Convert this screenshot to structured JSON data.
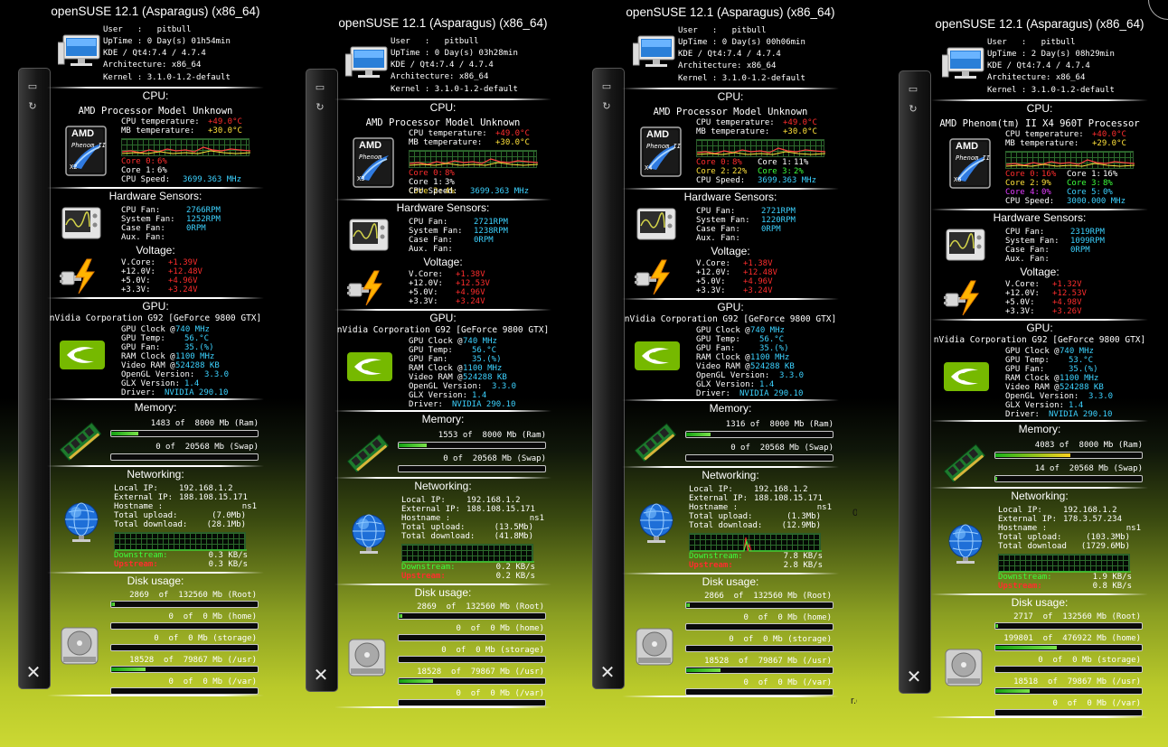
{
  "screenshots": [
    {
      "system": {
        "title": "openSUSE 12.1 (Asparagus) (x86_64)",
        "user": "User   :   pitbull",
        "uptime": "UpTime : 0 Day(s) 01h54min",
        "kde": "KDE / Qt4:7.4 / 4.7.4",
        "arch": "Architecture: x86_64",
        "kernel": "Kernel : 3.1.0-1.2-default"
      },
      "cpu": {
        "section": "CPU:",
        "name": "AMD Processor Model Unknown",
        "cpu_temp_label": "CPU temperature:",
        "cpu_temp": "+49.0°C",
        "mb_temp_label": "MB temperature:",
        "mb_temp": "+30.0°C",
        "cores": [
          {
            "label": "Core 0:",
            "value": "6%",
            "color": "rd"
          },
          {
            "label": "Core 1:",
            "value": "6%",
            "color": "lbl"
          }
        ],
        "speed_label": "CPU Speed:",
        "speed": "3699.363 MHz",
        "chip_brand": "AMD",
        "chip_model": "Phenom II",
        "chip_cores": "X2"
      },
      "sensors": {
        "section": "Hardware Sensors:",
        "cpu_fan_label": "CPU Fan:",
        "cpu_fan": "2766RPM",
        "sys_fan_label": "System Fan:",
        "sys_fan": "1252RPM",
        "case_fan_label": "Case Fan:",
        "case_fan": "0RPM",
        "aux_fan_label": "Aux. Fan:",
        "aux_fan": ""
      },
      "voltage": {
        "section": "Voltage:",
        "vcore_label": "V.Core:",
        "vcore": "+1.39V",
        "v12_label": "+12.0V:",
        "v12": "+12.48V",
        "v5_label": "+5.0V:",
        "v5": "+4.96V",
        "v33_label": "+3.3V:",
        "v33": "+3.24V"
      },
      "gpu": {
        "section": "GPU:",
        "name": "nVidia Corporation G92 [GeForce 9800 GTX]",
        "clock_label": "GPU Clock @",
        "clock": "740 MHz",
        "temp_label": "GPU Temp:",
        "temp": "56.°C",
        "fan_label": "GPU Fan:",
        "fan": "35.(%)",
        "ram_clock_label": "RAM Clock @",
        "ram_clock": "1100 MHz",
        "vram_label": "Video RAM @",
        "vram": "524288 KB",
        "opengl_label": "OpenGL Version:",
        "opengl": "3.3.0",
        "glx_label": "GLX Version:",
        "glx": "1.4",
        "driver_label": "Driver:",
        "driver": "NVIDIA 290.10"
      },
      "memory": {
        "section": "Memory:",
        "ram_text": "1483 of  8000 Mb (Ram)",
        "ram_fraction": 0.185,
        "swap_text": "0 of  20568 Mb (Swap)",
        "swap_fraction": 0.0
      },
      "network": {
        "section": "Networking:",
        "local_ip_label": "Local IP:",
        "local_ip": "192.168.1.2",
        "ext_ip_label": "External IP:",
        "ext_ip": "188.108.15.171",
        "hostname_label": "Hostname :",
        "hostname": "ns1",
        "upload_label": "Total upload:",
        "upload": "(7.0Mb)",
        "download_label": "Total download:",
        "download": "(28.1Mb)",
        "down_rate_label": "Downstream:",
        "down_rate": "0.3 KB/s",
        "up_rate_label": "Upstream:",
        "up_rate": "0.3 KB/s",
        "graph_spike": false
      },
      "disk": {
        "section": "Disk usage:",
        "rows": [
          {
            "text": "2869  of  132560 Mb (Root)",
            "fraction": 0.022
          },
          {
            "text": "0  of  0 Mb (home)",
            "fraction": 0
          },
          {
            "text": "0  of  0 Mb (storage)",
            "fraction": 0
          },
          {
            "text": "18528  of  79867 Mb (/usr)",
            "fraction": 0.232
          },
          {
            "text": "0  of  0 Mb (/var)",
            "fraction": 0
          }
        ]
      }
    },
    {
      "system": {
        "title": "openSUSE 12.1 (Asparagus) (x86_64)",
        "user": "User   :   pitbull",
        "uptime": "UpTime : 0 Day(s) 03h28min",
        "kde": "KDE / Qt4:7.4 / 4.7.4",
        "arch": "Architecture: x86_64",
        "kernel": "Kernel : 3.1.0-1.2-default"
      },
      "cpu": {
        "section": "CPU:",
        "name": "AMD Processor Model Unknown",
        "cpu_temp_label": "CPU temperature:",
        "cpu_temp": "+49.0°C",
        "mb_temp_label": "MB temperature:",
        "mb_temp": "+30.0°C",
        "cores": [
          {
            "label": "Core 0:",
            "value": "8%",
            "color": "rd"
          },
          {
            "label": "Core 1:",
            "value": "3%",
            "color": "lbl"
          },
          {
            "label": "Core 2:",
            "value": "4%",
            "color": "yl"
          }
        ],
        "speed_label": "CPU Speed:",
        "speed": "3699.363 MHz",
        "chip_brand": "AMD",
        "chip_model": "Phenom",
        "chip_cores": "X3"
      },
      "sensors": {
        "section": "Hardware Sensors:",
        "cpu_fan_label": "CPU Fan:",
        "cpu_fan": "2721RPM",
        "sys_fan_label": "System Fan:",
        "sys_fan": "1238RPM",
        "case_fan_label": "Case Fan:",
        "case_fan": "0RPM",
        "aux_fan_label": "Aux. Fan:",
        "aux_fan": ""
      },
      "voltage": {
        "section": "Voltage:",
        "vcore_label": "V.Core:",
        "vcore": "+1.38V",
        "v12_label": "+12.0V:",
        "v12": "+12.53V",
        "v5_label": "+5.0V:",
        "v5": "+4.96V",
        "v33_label": "+3.3V:",
        "v33": "+3.24V"
      },
      "gpu": {
        "section": "GPU:",
        "name": "nVidia Corporation G92 [GeForce 9800 GTX]",
        "clock_label": "GPU Clock @",
        "clock": "740 MHz",
        "temp_label": "GPU Temp:",
        "temp": "56.°C",
        "fan_label": "GPU Fan:",
        "fan": "35.(%)",
        "ram_clock_label": "RAM Clock @",
        "ram_clock": "1100 MHz",
        "vram_label": "Video RAM @",
        "vram": "524288 KB",
        "opengl_label": "OpenGL Version:",
        "opengl": "3.3.0",
        "glx_label": "GLX Version:",
        "glx": "1.4",
        "driver_label": "Driver:",
        "driver": "NVIDIA 290.10"
      },
      "memory": {
        "section": "Memory:",
        "ram_text": "1553 of  8000 Mb (Ram)",
        "ram_fraction": 0.194,
        "swap_text": "0 of  20568 Mb (Swap)",
        "swap_fraction": 0.0
      },
      "network": {
        "section": "Networking:",
        "local_ip_label": "Local IP:",
        "local_ip": "192.168.1.2",
        "ext_ip_label": "External IP:",
        "ext_ip": "188.108.15.171",
        "hostname_label": "Hostname :",
        "hostname": "ns1",
        "upload_label": "Total upload:",
        "upload": "(13.5Mb)",
        "download_label": "Total download:",
        "download": "(41.8Mb)",
        "down_rate_label": "Downstream:",
        "down_rate": "0.2 KB/s",
        "up_rate_label": "Upstream:",
        "up_rate": "0.2 KB/s",
        "graph_spike": false
      },
      "disk": {
        "section": "Disk usage:",
        "rows": [
          {
            "text": "2869  of  132560 Mb (Root)",
            "fraction": 0.022
          },
          {
            "text": "0  of  0 Mb (home)",
            "fraction": 0
          },
          {
            "text": "0  of  0 Mb (storage)",
            "fraction": 0
          },
          {
            "text": "18528  of  79867 Mb (/usr)",
            "fraction": 0.232
          },
          {
            "text": "0  of  0 Mb (/var)",
            "fraction": 0
          }
        ]
      }
    },
    {
      "system": {
        "title": "openSUSE 12.1 (Asparagus) (x86_64)",
        "user": "User   :   pitbull",
        "uptime": "UpTime : 0 Day(s) 00h06min",
        "kde": "KDE / Qt4:7.4 / 4.7.4",
        "arch": "Architecture: x86_64",
        "kernel": "Kernel : 3.1.0-1.2-default"
      },
      "cpu": {
        "section": "CPU:",
        "name": "AMD Processor Model Unknown",
        "cpu_temp_label": "CPU temperature:",
        "cpu_temp": "+49.0°C",
        "mb_temp_label": "MB temperature:",
        "mb_temp": "+30.0°C",
        "cores": [
          {
            "label": "Core 0:",
            "value": "8%",
            "color": "rd"
          },
          {
            "label": "Core 1:",
            "value": "11%",
            "color": "lbl"
          },
          {
            "label": "Core 2:",
            "value": "22%",
            "color": "yl"
          },
          {
            "label": "Core 3:",
            "value": "2%",
            "color": "gr"
          }
        ],
        "speed_label": "CPU Speed:",
        "speed": "3699.363 MHz",
        "chip_brand": "AMD",
        "chip_model": "Phenom II",
        "chip_cores": "X4"
      },
      "sensors": {
        "section": "Hardware Sensors:",
        "cpu_fan_label": "CPU Fan:",
        "cpu_fan": "2721RPM",
        "sys_fan_label": "System Fan:",
        "sys_fan": "1220RPM",
        "case_fan_label": "Case Fan:",
        "case_fan": "0RPM",
        "aux_fan_label": "Aux. Fan:",
        "aux_fan": ""
      },
      "voltage": {
        "section": "Voltage:",
        "vcore_label": "V.Core:",
        "vcore": "+1.38V",
        "v12_label": "+12.0V:",
        "v12": "+12.48V",
        "v5_label": "+5.0V:",
        "v5": "+4.96V",
        "v33_label": "+3.3V:",
        "v33": "+3.24V"
      },
      "gpu": {
        "section": "GPU:",
        "name": "nVidia Corporation G92 [GeForce 9800 GTX]",
        "clock_label": "GPU Clock @",
        "clock": "740 MHz",
        "temp_label": "GPU Temp:",
        "temp": "56.°C",
        "fan_label": "GPU Fan:",
        "fan": "35.(%)",
        "ram_clock_label": "RAM Clock @",
        "ram_clock": "1100 MHz",
        "vram_label": "Video RAM @",
        "vram": "524288 KB",
        "opengl_label": "OpenGL Version:",
        "opengl": "3.3.0",
        "glx_label": "GLX Version:",
        "glx": "1.4",
        "driver_label": "Driver:",
        "driver": "NVIDIA 290.10"
      },
      "memory": {
        "section": "Memory:",
        "ram_text": "1316 of  8000 Mb (Ram)",
        "ram_fraction": 0.165,
        "swap_text": "0 of  20568 Mb (Swap)",
        "swap_fraction": 0.0
      },
      "network": {
        "section": "Networking:",
        "local_ip_label": "Local IP:",
        "local_ip": "192.168.1.2",
        "ext_ip_label": "External IP:",
        "ext_ip": "188.108.15.171",
        "hostname_label": "Hostname :",
        "hostname": "ns1",
        "upload_label": "Total upload:",
        "upload": "(1.3Mb)",
        "download_label": "Total download:",
        "download": "(12.9Mb)",
        "down_rate_label": "Downstream:",
        "down_rate": "7.8 KB/s",
        "up_rate_label": "Upstream:",
        "up_rate": "2.8 KB/s",
        "graph_spike": true
      },
      "disk": {
        "section": "Disk usage:",
        "rows": [
          {
            "text": "2866  of  132560 Mb (Root)",
            "fraction": 0.022
          },
          {
            "text": "0  of  0 Mb (home)",
            "fraction": 0
          },
          {
            "text": "0  of  0 Mb (storage)",
            "fraction": 0
          },
          {
            "text": "18528  of  79867 Mb (/usr)",
            "fraction": 0.232
          },
          {
            "text": "0  of  0 Mb (/var)",
            "fraction": 0
          }
        ]
      }
    },
    {
      "system": {
        "title": "openSUSE 12.1 (Asparagus) (x86_64)",
        "user": "User   :   pitbull",
        "uptime": "UpTime : 2 Day(s) 08h29min",
        "kde": "KDE / Qt4:7.4 / 4.7.4",
        "arch": "Architecture: x86_64",
        "kernel": "Kernel : 3.1.0-1.2-default"
      },
      "cpu": {
        "section": "CPU:",
        "name": "AMD Phenom(tm) II X4 960T Processor",
        "cpu_temp_label": "CPU temperature:",
        "cpu_temp": "+40.0°C",
        "mb_temp_label": "MB temperature:",
        "mb_temp": "+29.0°C",
        "cores": [
          {
            "label": "Core 0:",
            "value": "16%",
            "color": "rd"
          },
          {
            "label": "Core 1:",
            "value": "16%",
            "color": "lbl"
          },
          {
            "label": "Core 2:",
            "value": "9%",
            "color": "yl"
          },
          {
            "label": "Core 3:",
            "value": "8%",
            "color": "gr"
          },
          {
            "label": "Core 4:",
            "value": "0%",
            "color": "mg"
          },
          {
            "label": "Core 5:",
            "value": "0%",
            "color": "cy"
          }
        ],
        "speed_label": "CPU Speed:",
        "speed": "3000.000 MHz",
        "chip_brand": "AMD",
        "chip_model": "Phenom II",
        "chip_cores": "X6"
      },
      "sensors": {
        "section": "Hardware Sensors:",
        "cpu_fan_label": "CPU Fan:",
        "cpu_fan": "2319RPM",
        "sys_fan_label": "System Fan:",
        "sys_fan": "1099RPM",
        "case_fan_label": "Case Fan:",
        "case_fan": "0RPM",
        "aux_fan_label": "Aux. Fan:",
        "aux_fan": ""
      },
      "voltage": {
        "section": "Voltage:",
        "vcore_label": "V.Core:",
        "vcore": "+1.32V",
        "v12_label": "+12.0V:",
        "v12": "+12.53V",
        "v5_label": "+5.0V:",
        "v5": "+4.98V",
        "v33_label": "+3.3V:",
        "v33": "+3.26V"
      },
      "gpu": {
        "section": "GPU:",
        "name": "nVidia Corporation G92 [GeForce 9800 GTX]",
        "clock_label": "GPU Clock @",
        "clock": "740 MHz",
        "temp_label": "GPU Temp:",
        "temp": "53.°C",
        "fan_label": "GPU Fan:",
        "fan": "35.(%)",
        "ram_clock_label": "RAM Clock @",
        "ram_clock": "1100 MHz",
        "vram_label": "Video RAM @",
        "vram": "524288 KB",
        "opengl_label": "OpenGL Version:",
        "opengl": "3.3.0",
        "glx_label": "GLX Version:",
        "glx": "1.4",
        "driver_label": "Driver:",
        "driver": "NVIDIA 290.10"
      },
      "memory": {
        "section": "Memory:",
        "ram_text": "4083 of  8000 Mb (Ram)",
        "ram_fraction": 0.51,
        "swap_text": "14 of  20568 Mb (Swap)",
        "swap_fraction": 0.001
      },
      "network": {
        "section": "Networking:",
        "local_ip_label": "Local IP:",
        "local_ip": "192.168.1.2",
        "ext_ip_label": "External IP:",
        "ext_ip": "178.3.57.234",
        "hostname_label": "Hostname :",
        "hostname": "ns1",
        "upload_label": "Total upload:",
        "upload": "(103.3Mb)",
        "download_label": "Total download",
        "download": "(1729.6Mb)",
        "down_rate_label": "Downstream:",
        "down_rate": "1.9 KB/s",
        "up_rate_label": "Upstream:",
        "up_rate": "0.8 KB/s",
        "graph_spike": false
      },
      "disk": {
        "section": "Disk usage:",
        "rows": [
          {
            "text": "2717  of  132560 Mb (Root)",
            "fraction": 0.02
          },
          {
            "text": "199801  of  476922 Mb (home)",
            "fraction": 0.419
          },
          {
            "text": "0  of  0 Mb (storage)",
            "fraction": 0
          },
          {
            "text": "18518  of  79867 Mb (/usr)",
            "fraction": 0.232
          },
          {
            "text": "0  of  0 Mb (/var)",
            "fraction": 0
          }
        ]
      }
    }
  ],
  "overlay": {
    "temp_fragment": "0 °C",
    "url_fragment": "r.com"
  },
  "sidebar": {
    "close_glyph": "✕",
    "display_glyph": "▭",
    "refresh_glyph": "↻"
  },
  "colors": {
    "value_cyan": "#3cd2ff",
    "warn_red": "#ff2d2d",
    "core_yellow": "#ffe13a",
    "core_green": "#3cff3c",
    "core_magenta": "#e23cff",
    "graph_green": "#2c6b2c",
    "bar_fill": "#7ae34a"
  }
}
